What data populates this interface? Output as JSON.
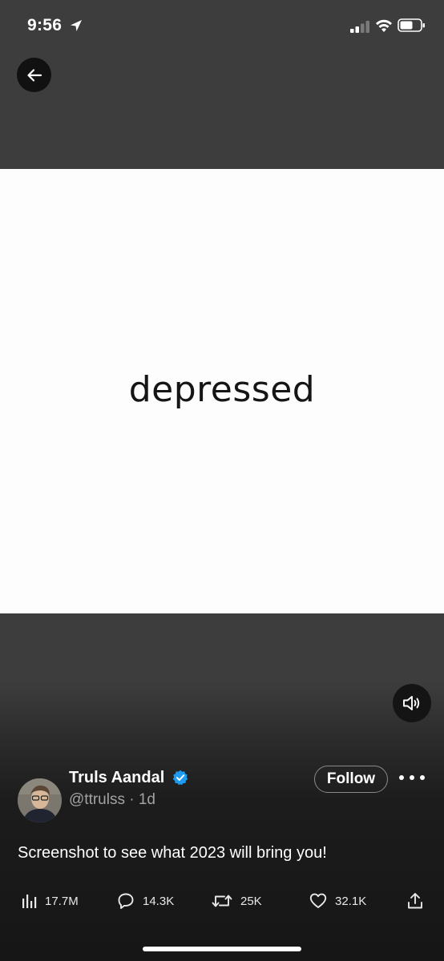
{
  "status_bar": {
    "time": "9:56",
    "icons": [
      "location-arrow-icon",
      "cellular-signal-icon",
      "wifi-icon",
      "battery-icon"
    ]
  },
  "media": {
    "word": "depressed",
    "background": "#fdfdfd"
  },
  "tweet": {
    "author_name": "Truls Aandal",
    "verified": true,
    "handle": "@ttrulss",
    "separator": "·",
    "age": "1d",
    "text": "Screenshot to see what 2023 will bring you!",
    "follow_label": "Follow"
  },
  "actions": {
    "views": "17.7M",
    "replies": "14.3K",
    "retweets": "25K",
    "likes": "32.1K"
  },
  "colors": {
    "verified_badge": "#1d9bf0",
    "top_background": "#3d3d3d",
    "bottom_background": "#161616",
    "muted_text": "#a3a3a3"
  }
}
